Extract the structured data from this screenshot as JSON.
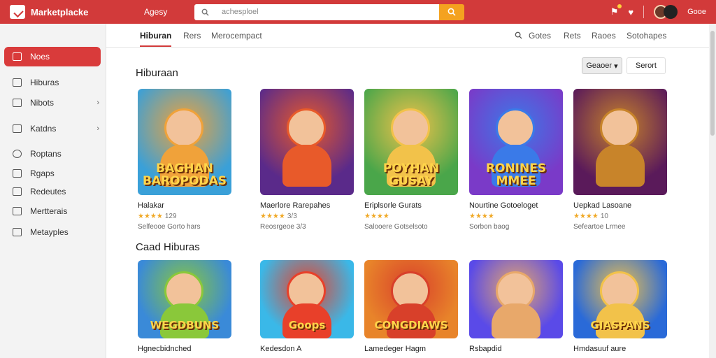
{
  "header": {
    "logo_text": "Marketplacke",
    "agency": "Agesy",
    "search_placeholder": "achesploel",
    "user_name": "Gooe",
    "icons": [
      "flag-icon",
      "heart-icon",
      "avatar"
    ]
  },
  "sidebar": {
    "active": "Noes",
    "items": [
      {
        "label": "Hiburas",
        "icon": "grid-icon",
        "chevron": false
      },
      {
        "label": "Nibots",
        "icon": "doc-icon",
        "chevron": true
      },
      {
        "label": "Katdns",
        "icon": "home-icon",
        "chevron": true
      },
      {
        "label": "Roptans",
        "icon": "circle-icon",
        "chevron": false
      },
      {
        "label": "Rgaps",
        "icon": "tag-icon",
        "chevron": false
      },
      {
        "label": "Redeutes",
        "icon": "bag-icon",
        "chevron": false
      },
      {
        "label": "Mertterais",
        "icon": "home-icon",
        "chevron": false
      },
      {
        "label": "Metayples",
        "icon": "edit-icon",
        "chevron": false
      }
    ]
  },
  "tabs": {
    "left": [
      "Hiburan",
      "Rers",
      "Merocempact"
    ],
    "right": [
      "Gotes",
      "Rets",
      "Raoes",
      "Sotohapes"
    ]
  },
  "section1": {
    "title": "Hiburaan",
    "sort_label": "Geaoer",
    "search_label": "Serort",
    "cards": [
      {
        "title": "Halakar",
        "rating": "★★★★",
        "rating_count": "129",
        "meta": "Selfeooe Gorto hars",
        "banner": "BAGHAN BAROPODAS",
        "bg": "#3aa0d8",
        "accent": "#f0a23a"
      },
      {
        "title": "Maerlore Rarepahes",
        "rating": "★★★★",
        "rating_count": "3/3",
        "meta": "Reosrgeoe 3/3",
        "banner": "",
        "bg": "#5a2a8a",
        "accent": "#e85a2a"
      },
      {
        "title": "Eriplsorle Gurats",
        "rating": "★★★★",
        "rating_count": "",
        "meta": "Salooere Gotselsoto",
        "banner": "POYHAN GUSAY",
        "bg": "#4aa64a",
        "accent": "#f2c24a"
      },
      {
        "title": "Nourtine Gotoeloget",
        "rating": "★★★★",
        "rating_count": "",
        "meta": "Sorbon baog",
        "banner": "RONINES MMEE",
        "bg": "#7a3ac8",
        "accent": "#3a7ae8"
      },
      {
        "title": "Uepkad Lasoane",
        "rating": "★★★★",
        "rating_count": "10",
        "meta": "Sefeartoe Lrmee",
        "banner": "",
        "bg": "#5a1a5a",
        "accent": "#c8842a"
      }
    ]
  },
  "section2": {
    "title": "Caad Hiburas",
    "cards": [
      {
        "title": "Hgnecbidnched",
        "banner": "WEGDBUNS",
        "bg": "#3a8ad8",
        "accent": "#8ac83a"
      },
      {
        "title": "Kedesdon A",
        "banner": "Goops",
        "bg": "#3ab8e8",
        "accent": "#e8402a"
      },
      {
        "title": "Lamedeger Hagm",
        "banner": "CONGDIAWS",
        "bg": "#e8842a",
        "accent": "#d8402a"
      },
      {
        "title": "Rsbapdid",
        "banner": "",
        "bg": "#5a4ae8",
        "accent": "#e8a86a"
      },
      {
        "title": "Hmdasuuf aure",
        "banner": "GIASPANS",
        "bg": "#2a6ad8",
        "accent": "#f2c24a"
      }
    ]
  }
}
